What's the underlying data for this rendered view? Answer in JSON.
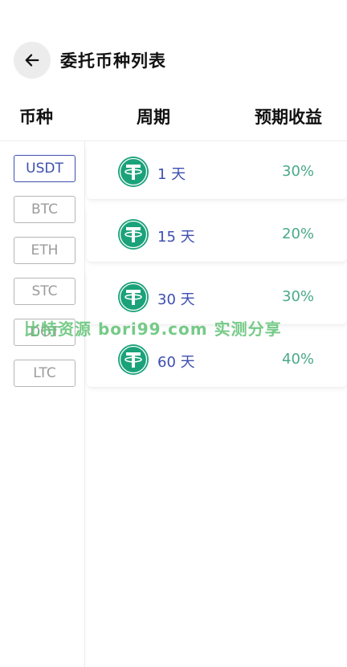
{
  "header": {
    "title": "委托币种列表"
  },
  "columns": {
    "coin": "币种",
    "period": "周期",
    "yield": "预期收益"
  },
  "sidebar": {
    "items": [
      {
        "label": "USDT",
        "active": true
      },
      {
        "label": "BTC",
        "active": false
      },
      {
        "label": "ETH",
        "active": false
      },
      {
        "label": "STC",
        "active": false
      },
      {
        "label": "DOT",
        "active": false
      },
      {
        "label": "LTC",
        "active": false
      }
    ]
  },
  "products": [
    {
      "icon": "tether-icon",
      "period": "1 天",
      "yield": "30%"
    },
    {
      "icon": "tether-icon",
      "period": "15 天",
      "yield": "20%"
    },
    {
      "icon": "tether-icon",
      "period": "30 天",
      "yield": "30%"
    },
    {
      "icon": "tether-icon",
      "period": "60 天",
      "yield": "40%"
    }
  ],
  "watermark": "比特资源 bori99.com 实测分享",
  "colors": {
    "accent": "#3d4fb0",
    "yield": "#4aa98a",
    "tether": "#1ba27a",
    "watermark": "#5fc274"
  }
}
